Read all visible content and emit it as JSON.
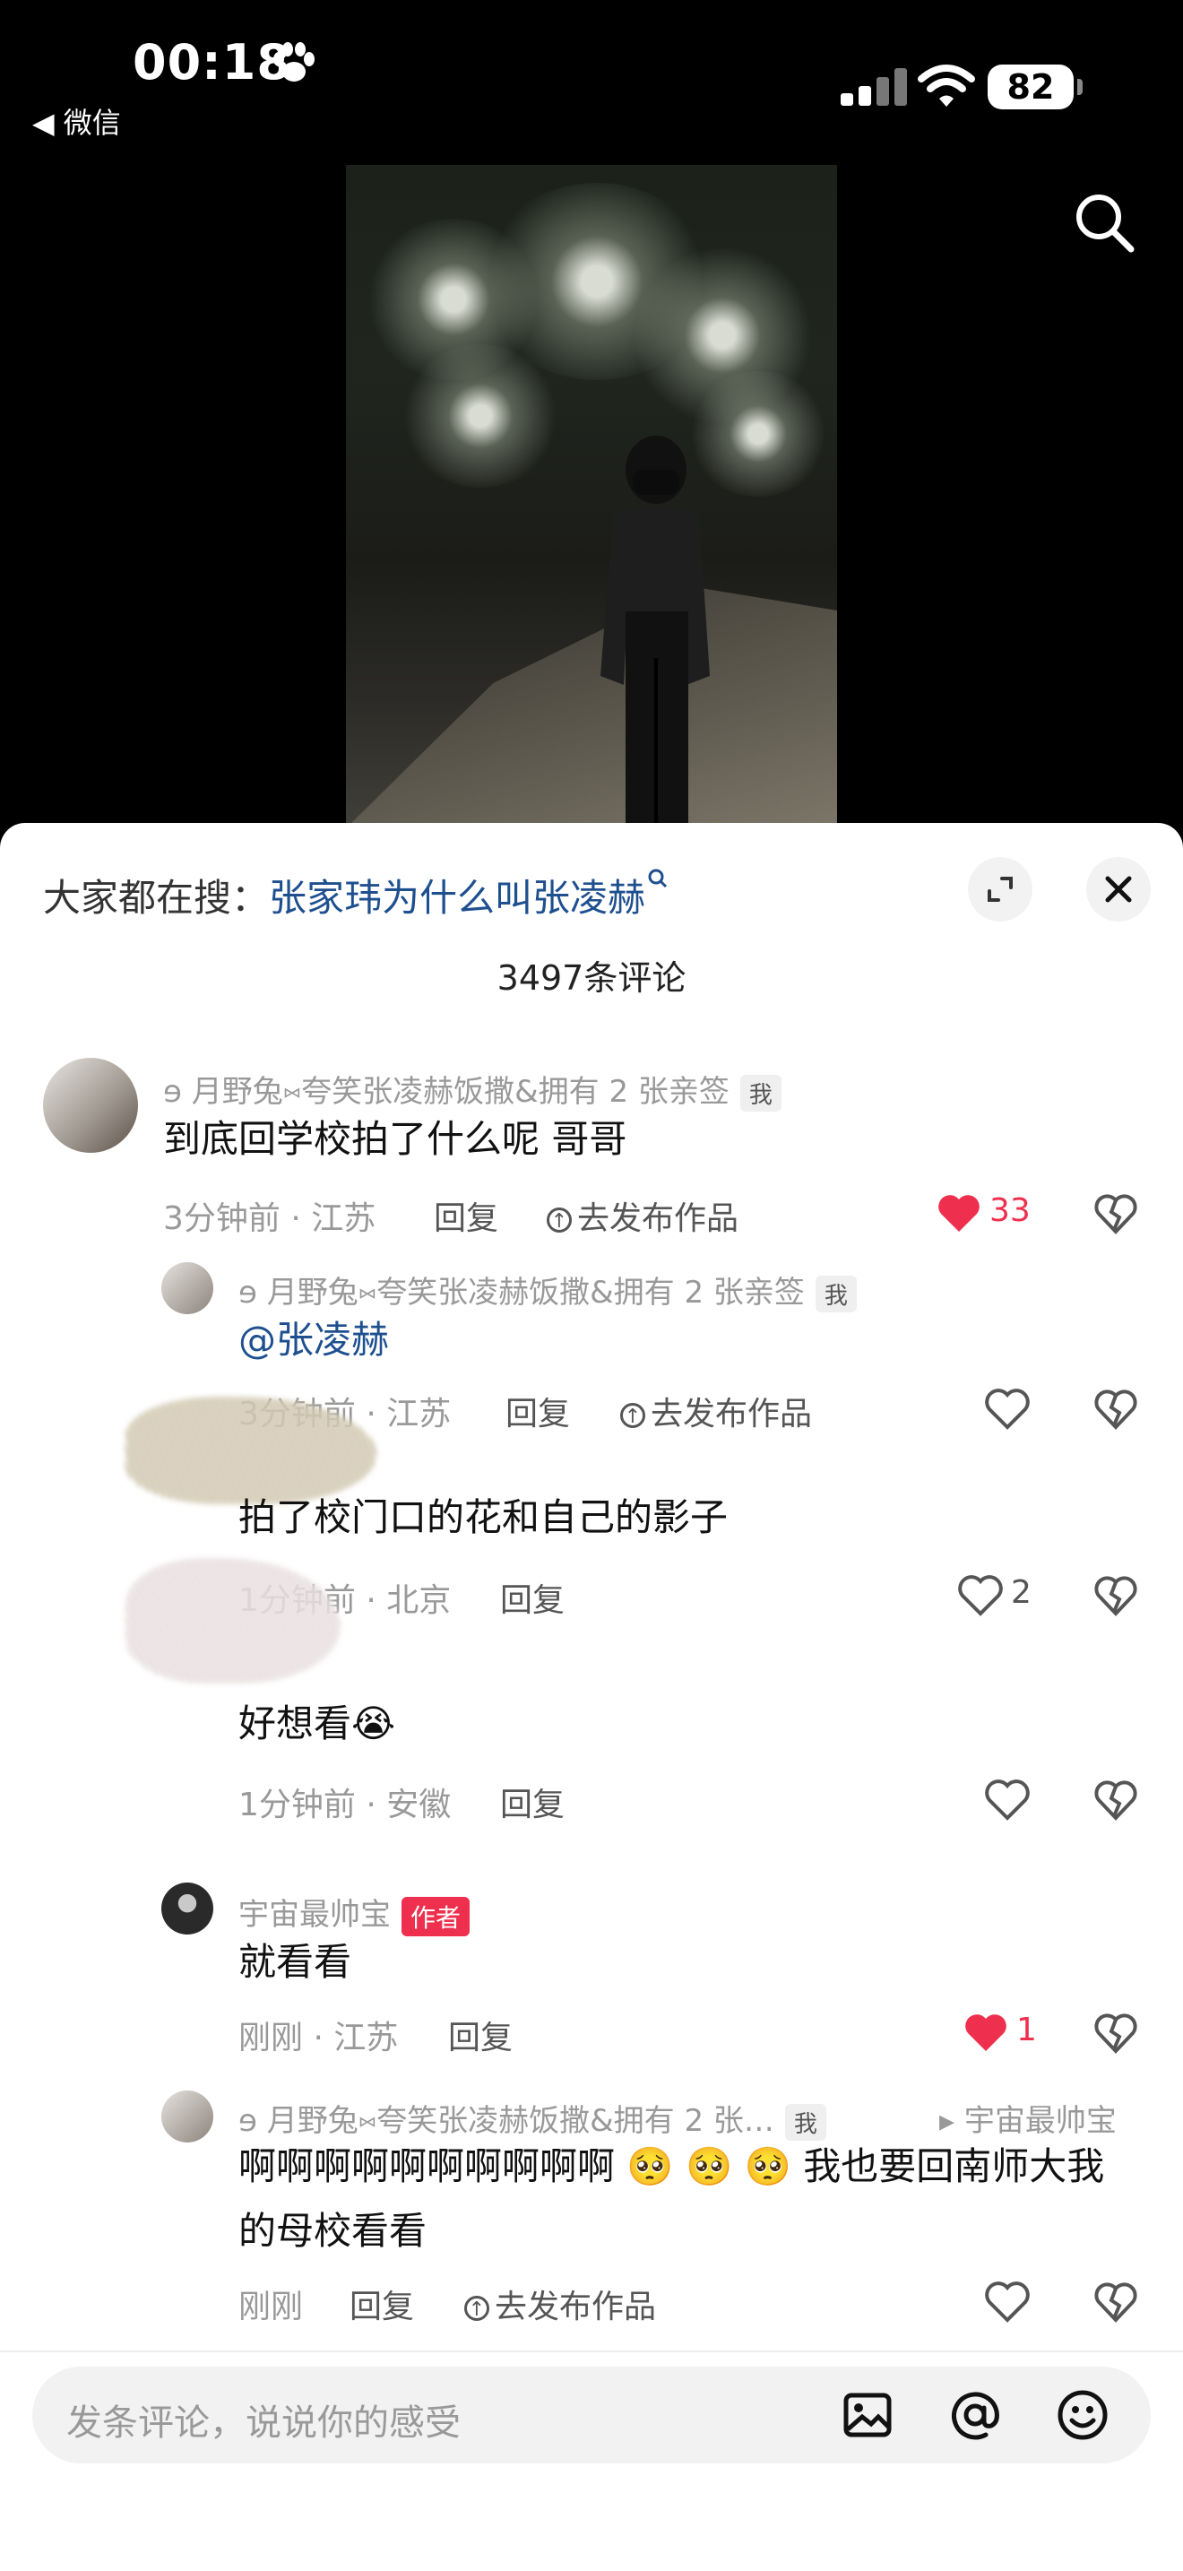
{
  "status_bar": {
    "time": "00:18",
    "back_label": "◀ 微信",
    "battery": "82"
  },
  "panel": {
    "hot_search_prefix": "大家都在搜：",
    "hot_search_query": "张家玮为什么叫张凌赫",
    "comment_count": "3497条评论"
  },
  "comments": [
    {
      "user": "ɘ 月野兔⑅夸笑张凌赫饭撒&拥有 2 张亲签",
      "badge": "我",
      "text": "到底回学校拍了什么呢 哥哥",
      "time_loc": "3分钟前 · 江苏",
      "reply": "回复",
      "publish": "去发布作品",
      "likes": "33",
      "liked": true
    },
    {
      "user": "ɘ 月野兔⑅夸笑张凌赫饭撒&拥有 2 张亲签",
      "badge": "我",
      "text": "@张凌赫",
      "time_loc": "3分钟前 · 江苏",
      "reply": "回复",
      "publish": "去发布作品"
    },
    {
      "text": "拍了校门口的花和自己的影子",
      "time_loc": "1分钟前 · 北京",
      "reply": "回复",
      "likes": "2"
    },
    {
      "text": "好想看😭",
      "time_loc": "1分钟前 · 安徽",
      "reply": "回复"
    },
    {
      "user": "宇宙最帅宝",
      "badge": "作者",
      "text": "就看看",
      "time_loc": "刚刚 · 江苏",
      "reply": "回复",
      "likes": "1",
      "liked": true
    },
    {
      "user": "ɘ 月野兔⑅夸笑张凌赫饭撒&拥有 2 张…",
      "badge": "我",
      "reply_to": "▸ 宇宙最帅宝",
      "text_line1": "啊啊啊啊啊啊啊啊啊啊 🥺 🥺 🥺 我也要回南师大我",
      "text_line2": "的母校看看",
      "time_loc": "刚刚",
      "reply": "回复",
      "publish": "去发布作品"
    }
  ],
  "input": {
    "placeholder": "发条评论，说说你的感受"
  },
  "colors": {
    "like_red": "#ee2f4e",
    "link_blue": "#1e4f8f",
    "author_badge": "#ee2f4e"
  },
  "icons": [
    "paw-icon",
    "signal-icon",
    "wifi-icon",
    "search-icon",
    "expand-icon",
    "close-icon",
    "heart-icon",
    "broken-heart-icon",
    "image-icon",
    "at-icon",
    "emoji-icon"
  ]
}
